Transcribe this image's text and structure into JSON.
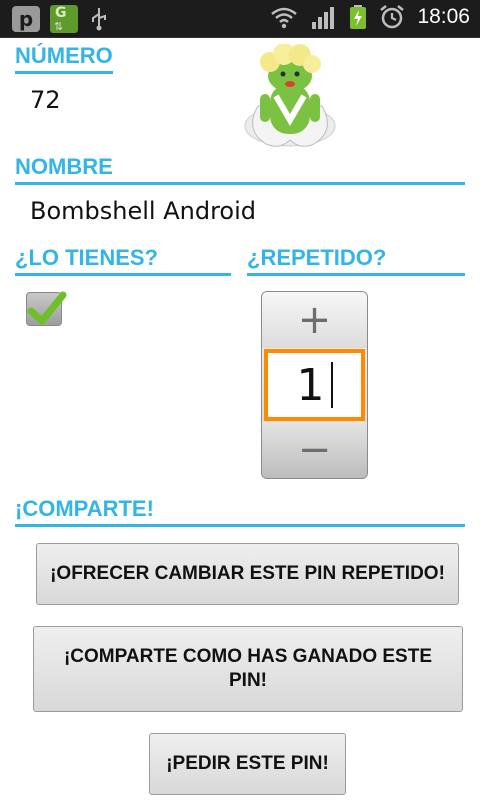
{
  "status_bar": {
    "left_icons": [
      "p-app-icon",
      "g-sync-icon",
      "usb-icon"
    ],
    "right_icons": [
      "wifi-icon",
      "signal-icon",
      "battery-charging-icon",
      "alarm-icon"
    ],
    "time": "18:06",
    "p_letter": "p",
    "g_letter": "G"
  },
  "form": {
    "numero_label": "NÚMERO",
    "numero_value": "72",
    "nombre_label": "NOMBRE",
    "nombre_value": "Bombshell Android",
    "lo_tienes_label": "¿LO TIENES?",
    "lo_tienes_checked": true,
    "repetido_label": "¿REPETIDO?",
    "repetido": {
      "plus_symbol": "+",
      "value": "1",
      "minus_symbol": "−"
    },
    "comparte_label": "¡COMPARTE!"
  },
  "actions": {
    "offer_label": "¡OFRECER CAMBIAR ESTE PIN REPETIDO!",
    "share_label": "¡COMPARTE COMO HAS GANADO ESTE PIN!",
    "request_label": "¡PEDIR ESTE PIN!"
  },
  "colors": {
    "accent": "#33b5e5",
    "focus": "#ff8a00",
    "check": "#6fbf2b",
    "status_bar_bg": "#1c1c1c"
  }
}
